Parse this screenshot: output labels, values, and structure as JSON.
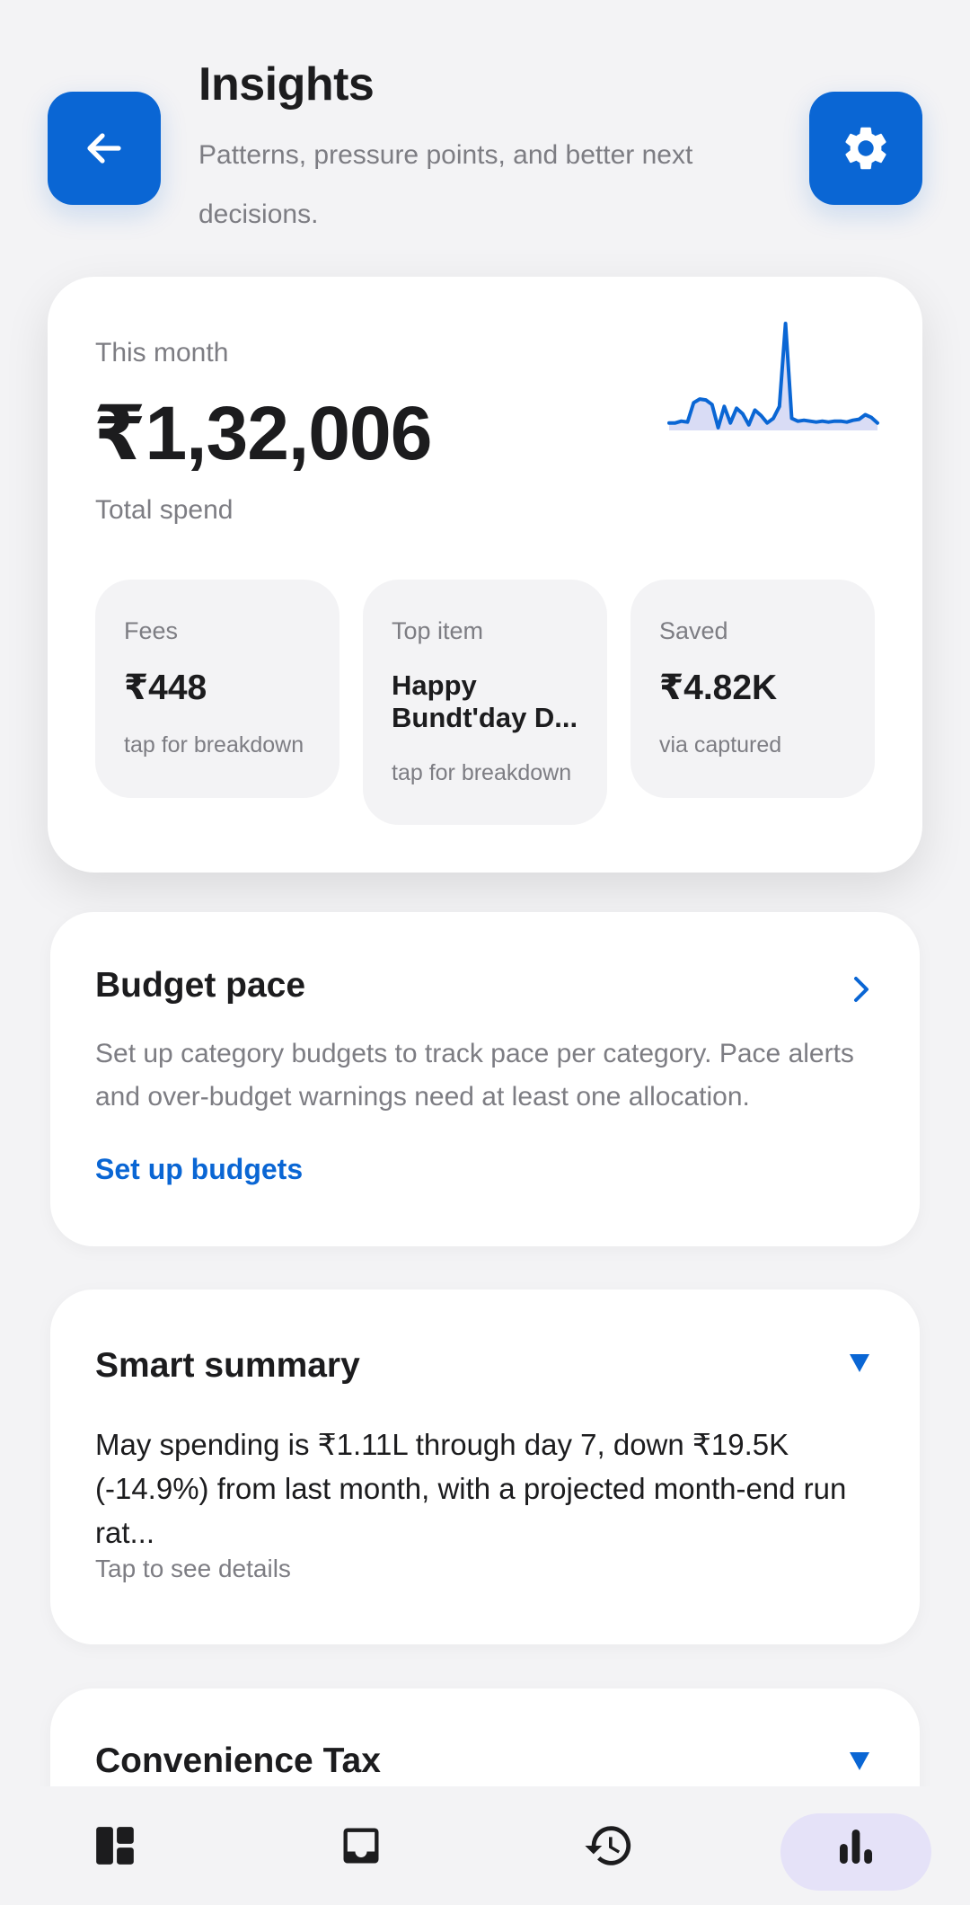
{
  "header": {
    "title": "Insights",
    "subtitle": "Patterns, pressure points, and better next decisions."
  },
  "hero": {
    "label": "This month",
    "amount": "₹1,32,006",
    "sublabel": "Total spend",
    "sparkline": [
      10,
      10,
      12,
      11,
      32,
      36,
      35,
      30,
      5,
      28,
      10,
      26,
      20,
      8,
      24,
      18,
      10,
      15,
      28,
      118,
      15,
      12,
      13,
      12,
      11,
      12,
      11,
      12,
      12,
      11,
      13,
      14,
      19,
      16,
      10
    ],
    "stats": [
      {
        "label": "Fees",
        "value": "₹448",
        "foot": "tap for breakdown"
      },
      {
        "label": "Top item",
        "value": "Happy Bundt'day D...",
        "foot": "tap for breakdown"
      },
      {
        "label": "Saved",
        "value": "₹4.82K",
        "foot": "via captured"
      }
    ]
  },
  "budget_card": {
    "title": "Budget pace",
    "text": "Set up category budgets to track pace per category. Pace alerts and over-budget warnings need at least one allocation.",
    "link": "Set up budgets"
  },
  "summary_card": {
    "title": "Smart summary",
    "text": "May spending is ₹1.11L through day 7, down ₹19.5K (-14.9%) from last month, with a projected month-end run rat...",
    "foot": "Tap to see details"
  },
  "convenience_card": {
    "title": "Convenience Tax"
  },
  "bottom_nav": {
    "items": [
      {
        "icon": "dashboard-icon"
      },
      {
        "icon": "inbox-icon"
      },
      {
        "icon": "history-icon"
      },
      {
        "icon": "insights-bar-chart-icon",
        "active": true
      }
    ]
  },
  "colors": {
    "accent": "#0a66d4",
    "active_pill": "#e5e2f8",
    "sparkline_fill": "#d9dcf5"
  }
}
